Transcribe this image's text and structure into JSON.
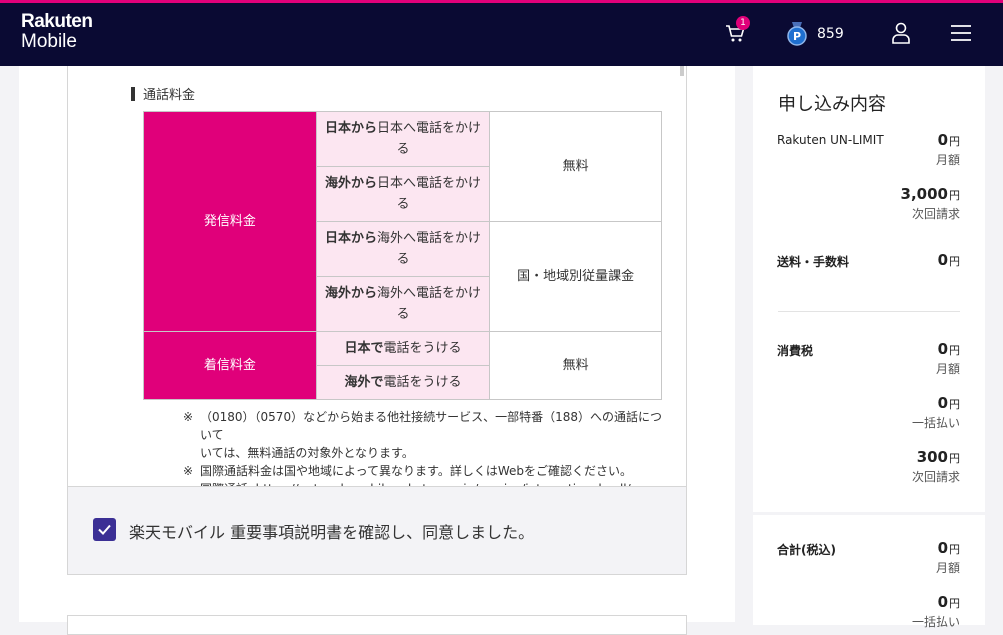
{
  "brand": {
    "line1": "Rakuten",
    "line2": "Mobile"
  },
  "header": {
    "cart_count": "1",
    "points": "859"
  },
  "call_fees": {
    "section_title": "通話料金",
    "rows": {
      "outgoing": "発信料金",
      "incoming": "着信料金",
      "jp_to_jp_bold": "日本から",
      "jp_to_jp": "日本へ電話をかける",
      "abroad_to_jp_bold": "海外から",
      "abroad_to_jp": "日本へ電話をかける",
      "jp_to_abroad_bold": "日本から",
      "jp_to_abroad": "海外へ電話をかける",
      "abroad_to_abroad_bold": "海外から",
      "abroad_to_abroad": "海外へ電話をかける",
      "recv_jp_bold": "日本で",
      "recv_jp": "電話をうける",
      "recv_abroad_bold": "海外で",
      "recv_abroad": "電話をうける",
      "free1": "無料",
      "intl": "国・地域別従量課金",
      "free2": "無料"
    },
    "notes": {
      "mark": "※",
      "note1": "（0180）（0570）などから始まる他社接続サービス、一部特番（188）への通話について",
      "note1b": "いては、無料通話の対象外となります。",
      "note2": "国際通話料金は国や地域によって異なります。詳しくはWebをご確認ください。",
      "note3": "国際通話",
      "note3_url": "https://network.mobile.rakuten.co.jp/service/international-call/"
    }
  },
  "agreement": {
    "label": "楽天モバイル 重要事項説明書を確認し、同意しました。"
  },
  "summary": {
    "title": "申し込み内容",
    "plan_label": "Rakuten UN-LIMIT",
    "plan_monthly": "0",
    "monthly": "月額",
    "plan_next": "3,000",
    "next_bill": "次回請求",
    "fee_label": "送料・手数料",
    "fee_value": "0",
    "tax_label": "消費税",
    "tax_monthly": "0",
    "tax_monthly_lbl": "月額",
    "tax_once": "0",
    "tax_once_lbl": "一括払い",
    "tax_next": "300",
    "tax_next_lbl": "次回請求",
    "total_label": "合計(税込)",
    "total_monthly": "0",
    "total_monthly_lbl": "月額",
    "total_once": "0",
    "total_once_lbl": "一括払い",
    "yen": "円"
  },
  "colors": {
    "brand": "#e0007a",
    "header_bg": "#0a0a33",
    "check": "#3b2f95"
  }
}
